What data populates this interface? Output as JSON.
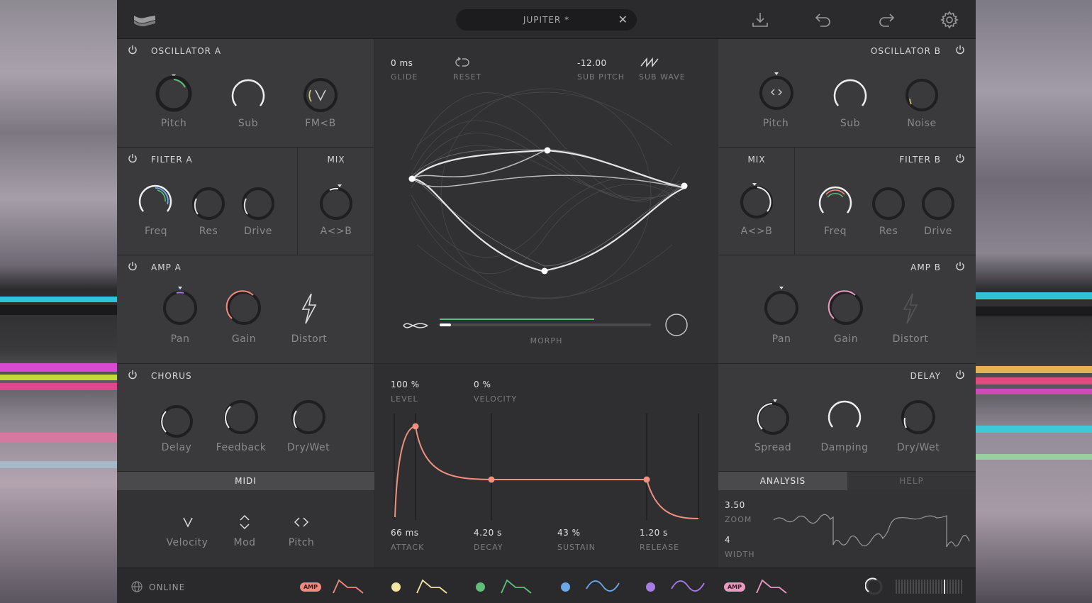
{
  "header": {
    "preset_name": "JUPITER *",
    "close_glyph": "✕"
  },
  "colors": {
    "accent_green": "#5fbf7a",
    "accent_blue": "#6aa8e8",
    "accent_pink": "#e89ac0",
    "accent_salmon": "#f08a7e",
    "accent_yellow": "#f1e6a4",
    "accent_purple": "#a77be8",
    "envelope": "#f0907e"
  },
  "osc_a": {
    "title": "OSCILLATOR A",
    "knobs": [
      "Pitch",
      "Sub",
      "FM<B"
    ]
  },
  "filter_a": {
    "title": "FILTER A",
    "knobs": [
      "Freq",
      "Res",
      "Drive"
    ]
  },
  "mix_a": {
    "title": "MIX",
    "knob": "A<>B"
  },
  "amp_a": {
    "title": "AMP A",
    "knobs": [
      "Pan",
      "Gain",
      "Distort"
    ]
  },
  "chorus": {
    "title": "CHORUS",
    "knobs": [
      "Delay",
      "Feedback",
      "Dry/Wet"
    ]
  },
  "midi": {
    "title": "MIDI",
    "items": [
      "Velocity",
      "Mod",
      "Pitch"
    ]
  },
  "osc_b": {
    "title": "OSCILLATOR B",
    "knobs": [
      "Pitch",
      "Sub",
      "Noise"
    ]
  },
  "mix_b": {
    "title": "MIX",
    "knob": "A<>B"
  },
  "filter_b": {
    "title": "FILTER B",
    "knobs": [
      "Freq",
      "Res",
      "Drive"
    ]
  },
  "amp_b": {
    "title": "AMP B",
    "knobs": [
      "Pan",
      "Gain",
      "Distort"
    ]
  },
  "delay": {
    "title": "DELAY",
    "knobs": [
      "Spread",
      "Damping",
      "Dry/Wet"
    ]
  },
  "analysis": {
    "tab_active": "ANALYSIS",
    "tab_inactive": "HELP",
    "zoom_value": "3.50",
    "zoom_label": "ZOOM",
    "width_value": "4",
    "width_label": "WIDTH"
  },
  "wave": {
    "glide_value": "0 ms",
    "glide_label": "GLIDE",
    "reset_label": "RESET",
    "sub_pitch_value": "-12.00",
    "sub_pitch_label": "SUB PITCH",
    "sub_wave_label": "SUB WAVE",
    "morph_label": "MORPH",
    "morph_position": 0.02
  },
  "envelope": {
    "level_value": "100 %",
    "level_label": "LEVEL",
    "velocity_value": "0 %",
    "velocity_label": "VELOCITY",
    "attack_value": "66 ms",
    "attack_label": "ATTACK",
    "decay_value": "4.20 s",
    "decay_label": "DECAY",
    "sustain_value": "43 %",
    "sustain_label": "SUSTAIN",
    "release_value": "1.20 s",
    "release_label": "RELEASE"
  },
  "footer": {
    "status": "ONLINE",
    "amp_tag": "AMP"
  },
  "icons": [
    "logo-icon",
    "download-icon",
    "undo-icon",
    "redo-icon",
    "gear-icon",
    "power-icon",
    "globe-icon",
    "lightning-icon",
    "loop-icon",
    "sawtooth-icon",
    "morph-wave-icon"
  ]
}
